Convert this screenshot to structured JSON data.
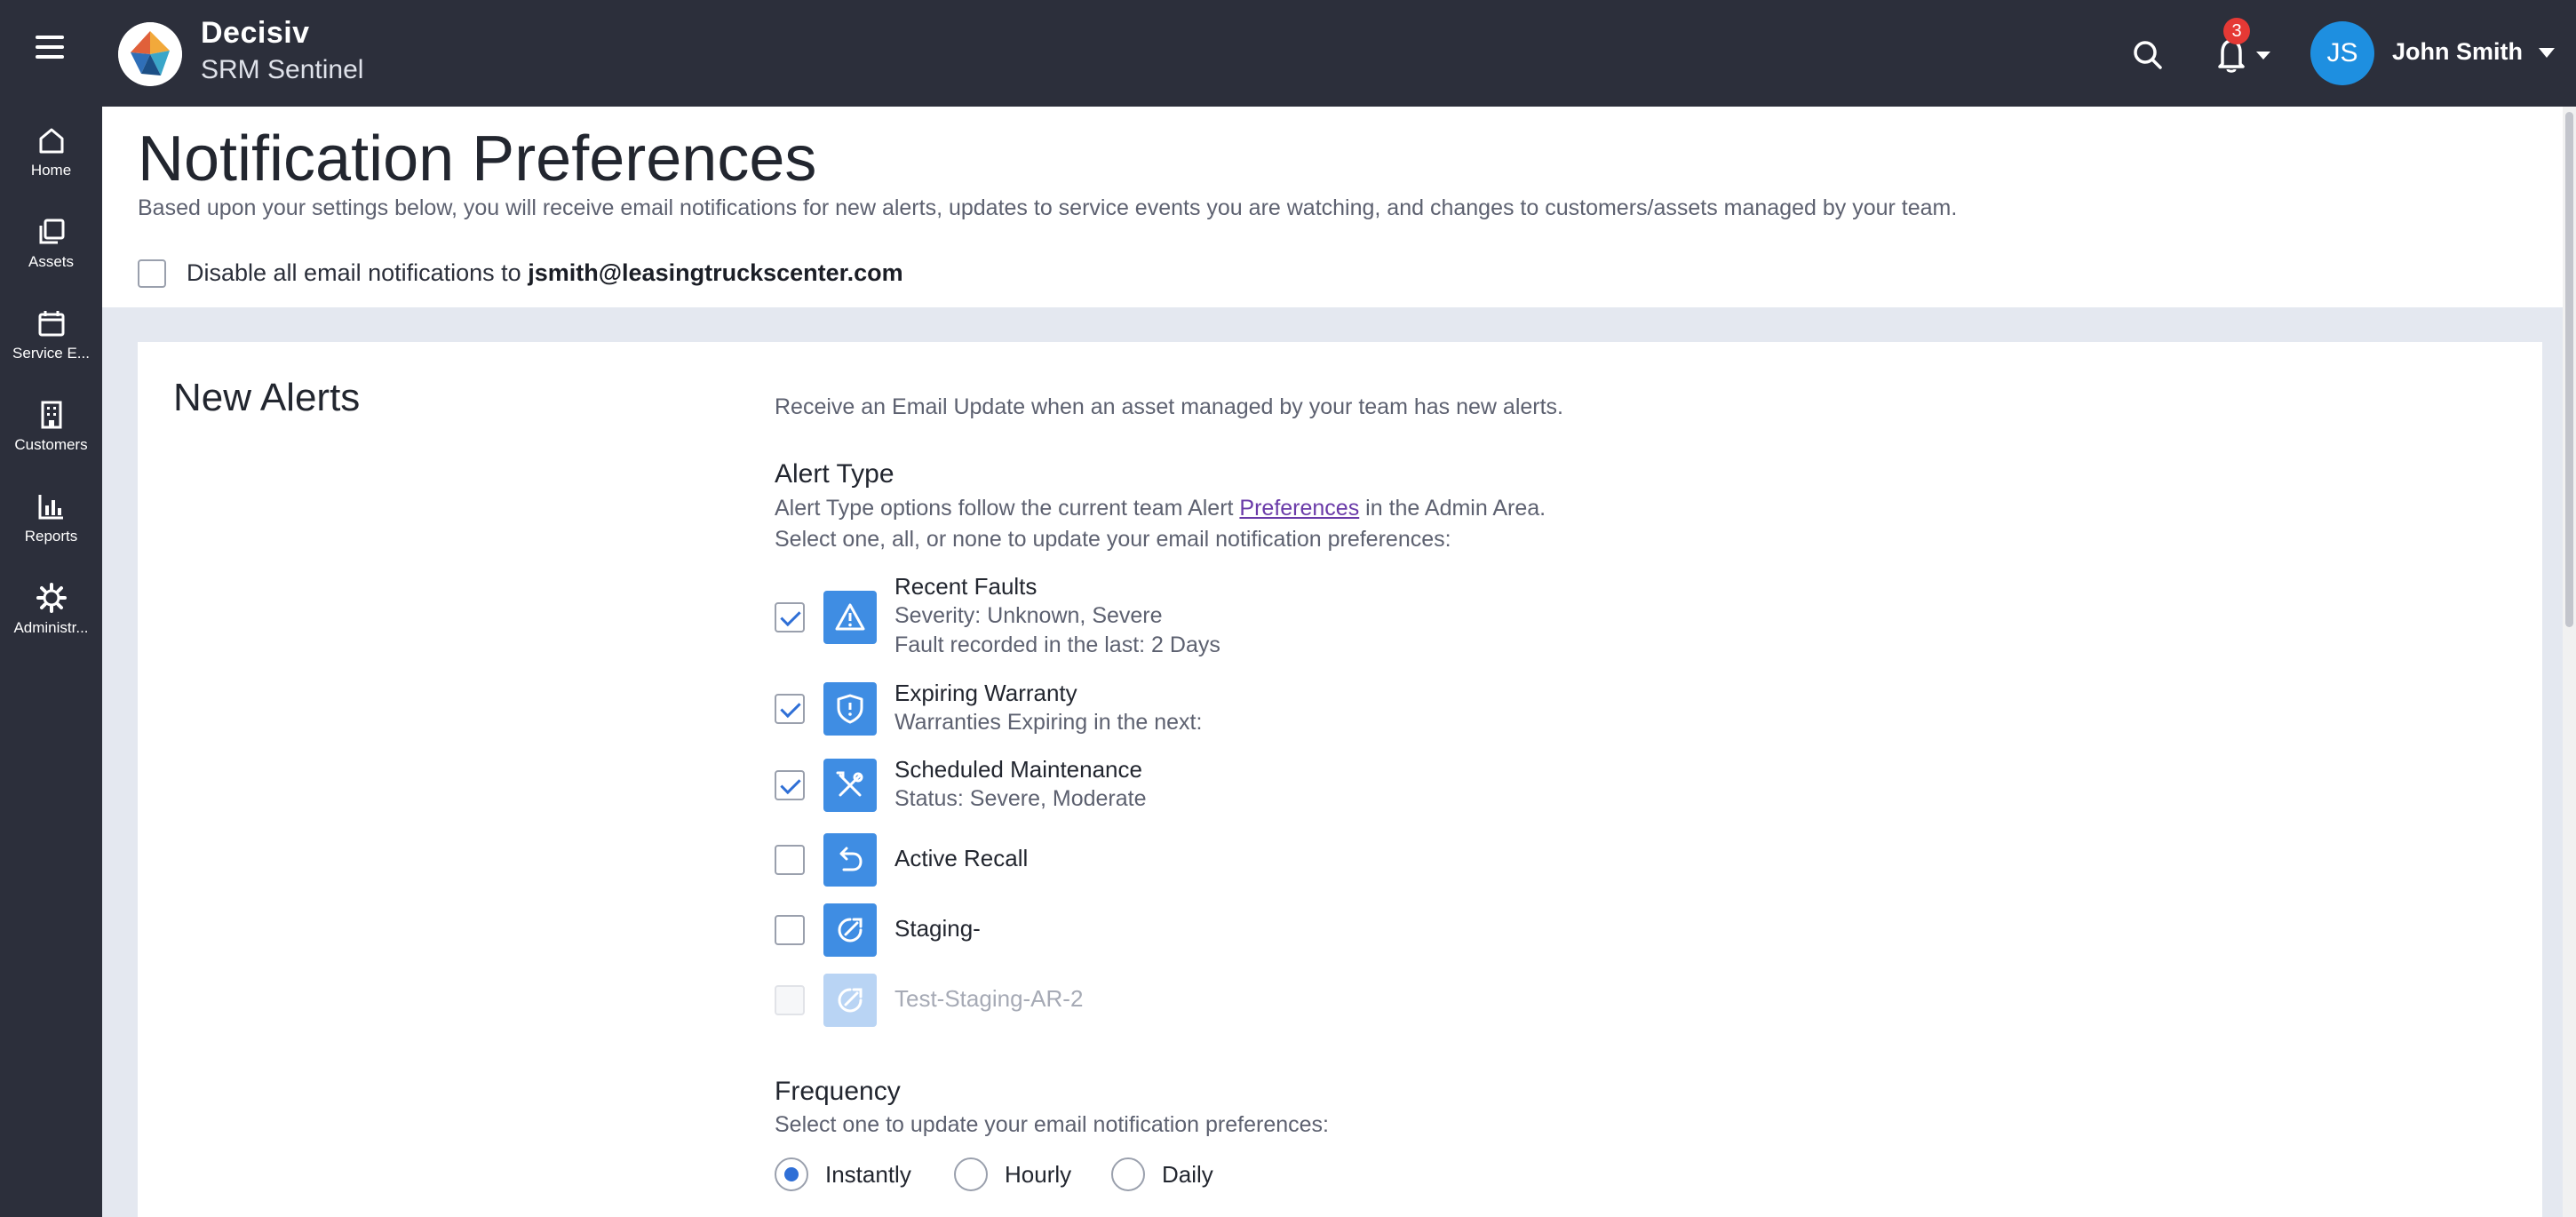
{
  "colors": {
    "topbar": "#2c2f3b",
    "sidebar": "#2c2f3b",
    "accent": "#3f8de3",
    "avatar": "#1e8fe0",
    "badge": "#e53935",
    "link": "#6a3aa8",
    "background": "#e4e8f0"
  },
  "topbar": {
    "brand_name": "Decisiv",
    "brand_sub": "SRM Sentinel",
    "notification_count": "3",
    "user_initials": "JS",
    "user_name": "John Smith"
  },
  "sidebar": {
    "items": [
      {
        "label": "Home",
        "icon": "home-icon"
      },
      {
        "label": "Assets",
        "icon": "assets-icon"
      },
      {
        "label": "Service E...",
        "icon": "calendar-icon"
      },
      {
        "label": "Customers",
        "icon": "building-icon"
      },
      {
        "label": "Reports",
        "icon": "bar-chart-icon"
      },
      {
        "label": "Administr...",
        "icon": "gear-icon"
      }
    ]
  },
  "header": {
    "title": "Notification Preferences",
    "description": "Based upon your settings below, you will receive email notifications for new alerts, updates to service events you are watching, and changes to customers/assets managed by your team.",
    "disable_label": "Disable all email notifications to",
    "disable_email": "jsmith@leasingtruckscenter.com",
    "disable_checked": false
  },
  "new_alerts": {
    "title": "New Alerts",
    "description": "Receive an Email Update when an asset managed by your team has new alerts.",
    "alert_type": {
      "heading": "Alert Type",
      "text_before_link": "Alert Type options follow the current team Alert",
      "link_text": "Preferences",
      "text_after_link": "in the Admin Area.",
      "instruction": "Select one, all, or none to update your email notification preferences:"
    },
    "alerts": [
      {
        "name": "Recent Faults",
        "details": [
          "Severity: Unknown, Severe",
          "Fault recorded in the last: 2 Days"
        ],
        "checked": true,
        "disabled": false,
        "icon": "warning-triangle-icon"
      },
      {
        "name": "Expiring Warranty",
        "details": [
          "Warranties Expiring in the next:"
        ],
        "checked": true,
        "disabled": false,
        "icon": "shield-icon"
      },
      {
        "name": "Scheduled Maintenance",
        "details": [
          "Status: Severe, Moderate"
        ],
        "checked": true,
        "disabled": false,
        "icon": "wrench-screwdriver-icon"
      },
      {
        "name": "Active Recall",
        "details": [],
        "checked": false,
        "disabled": false,
        "icon": "undo-arrow-icon"
      },
      {
        "name": "Staging-",
        "details": [],
        "checked": false,
        "disabled": false,
        "icon": "custom-alert-icon"
      },
      {
        "name": "Test-Staging-AR-2",
        "details": [],
        "checked": false,
        "disabled": true,
        "icon": "custom-alert-icon"
      }
    ],
    "frequency": {
      "heading": "Frequency",
      "instruction": "Select one to update your email notification preferences:",
      "options": [
        {
          "label": "Instantly",
          "selected": true
        },
        {
          "label": "Hourly",
          "selected": false
        },
        {
          "label": "Daily",
          "selected": false
        }
      ]
    }
  }
}
